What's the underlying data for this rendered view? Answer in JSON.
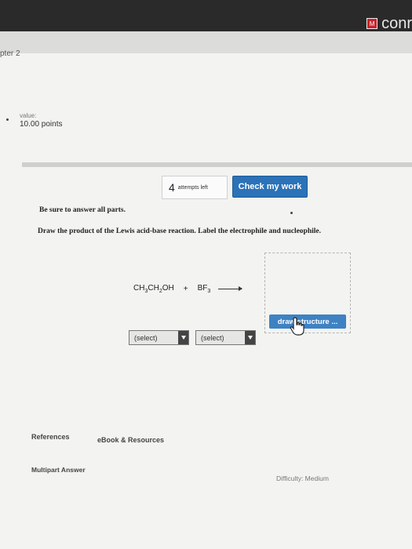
{
  "header": {
    "brand_text": "conr",
    "brand_icon_text": "M",
    "chapter": "pter 2"
  },
  "value": {
    "label": "value:",
    "points": "10.00 points"
  },
  "attempts": {
    "count": "4",
    "label": "attempts left"
  },
  "check_button": "Check my work",
  "instructions": {
    "line1": "Be sure to answer all parts.",
    "line2": "Draw the product of the Lewis acid-base reaction. Label the electrophile and nucleophile."
  },
  "reaction": {
    "plus": "+"
  },
  "draw_button": "draw structure ...",
  "selects": [
    "(select)",
    "(select)"
  ],
  "footer": {
    "references": "References",
    "ebook": "eBook & Resources",
    "multipart": "Multipart Answer",
    "difficulty": "Difficulty: Medium"
  },
  "colors": {
    "accent": "#2b72b8",
    "header": "#2a2a2a",
    "brand_red": "#c8222b"
  }
}
